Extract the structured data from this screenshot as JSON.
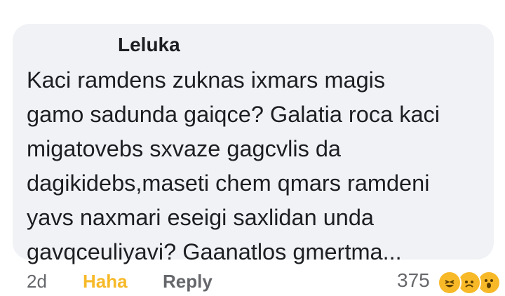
{
  "comment": {
    "author": "Leluka",
    "text": "Kaci ramdens zuknas ixmars magis\ngamo sadunda gaiqce? Galatia roca kaci\nmigatovebs sxvaze gagcvlis da\ndagikidebs,maseti chem qmars ramdeni\nyavs naxmari eseigi saxlidan unda\ngavqceuliyavi? Gaanatlos gmertma..."
  },
  "actions": {
    "time": "2d",
    "reaction_label": "Haha",
    "reply_label": "Reply",
    "reaction_count": "375",
    "reaction_icons": [
      "haha-emoji-icon",
      "sad-emoji-icon",
      "wow-emoji-icon"
    ]
  },
  "colors": {
    "thread_line": "#2d6ae0",
    "bubble": "#f0f2f5",
    "haha": "#f7b928"
  }
}
